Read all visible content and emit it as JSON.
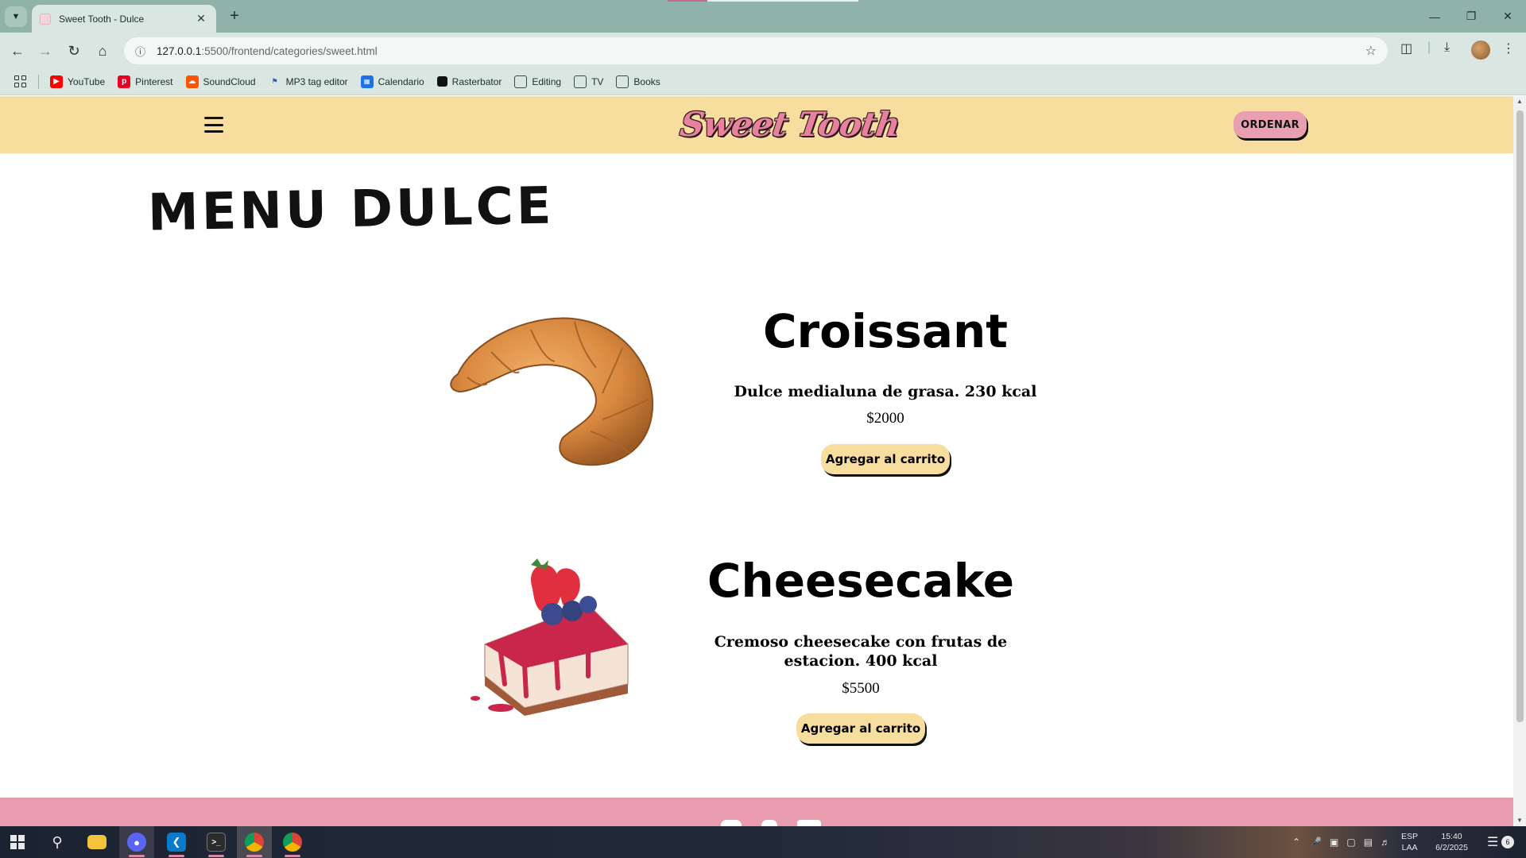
{
  "browser": {
    "tab_title": "Sweet Tooth - Dulce",
    "url_host": "127.0.0.1",
    "url_path": ":5500/frontend/categories/sweet.html",
    "bookmarks": [
      "YouTube",
      "Pinterest",
      "SoundCloud",
      "MP3 tag editor",
      "Calendario",
      "Rasterbator",
      "Editing",
      "TV",
      "Books"
    ]
  },
  "site": {
    "logo_text": "Sweet Tooth",
    "order_label": "ORDENAR",
    "page_title_word1": "MENU",
    "page_title_word2": "DULCE",
    "products": [
      {
        "name": "Croissant",
        "description": "Dulce medialuna de grasa. 230 kcal",
        "price": "$2000",
        "button_label": "Agregar al carrito"
      },
      {
        "name": "Cheesecake",
        "description": "Cremoso cheesecake con frutas de estacion. 400 kcal",
        "price": "$5500",
        "button_label": "Agregar al carrito"
      }
    ]
  },
  "colors": {
    "header_bg": "#f7dd9e",
    "accent_pink": "#e89cad",
    "logo_pink": "#e8819d",
    "browser_frame": "#8fb3a8"
  },
  "taskbar": {
    "lang_top": "ESP",
    "lang_bottom": "LAA",
    "time": "15:40",
    "date": "6/2/2025",
    "notification_count": "6"
  }
}
